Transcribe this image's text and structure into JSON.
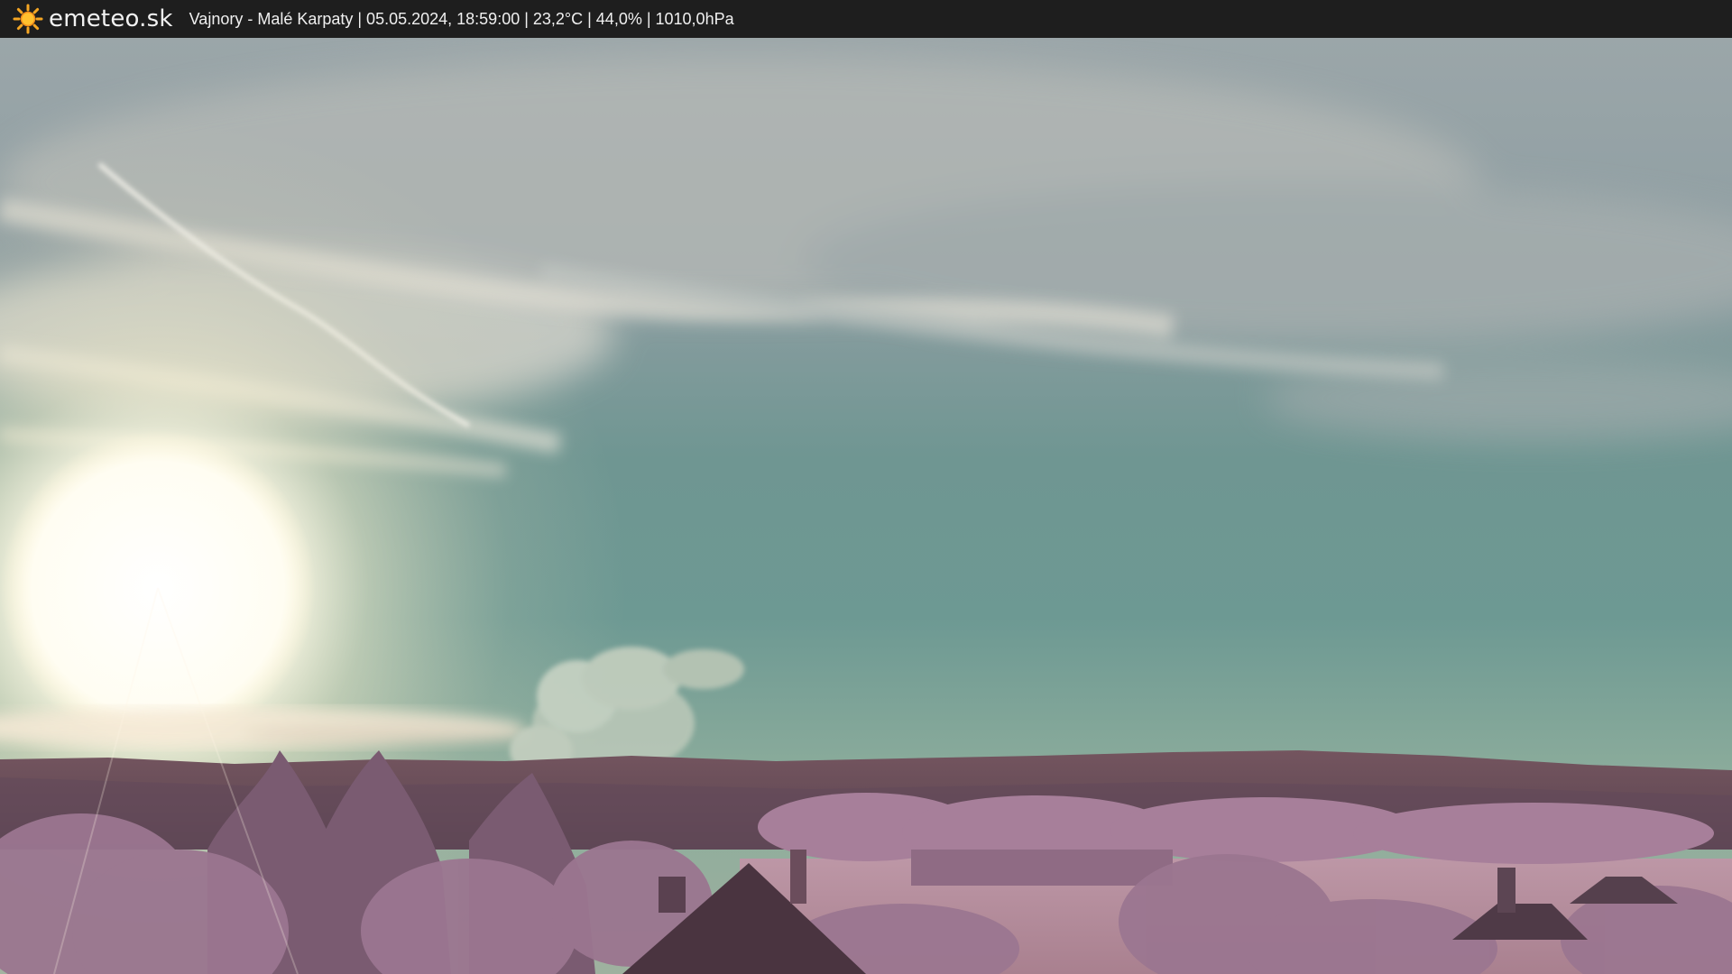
{
  "header": {
    "brand": "emeteo.sk",
    "logo_icon": "sun-icon",
    "caption": "Vajnory - Malé Karpaty | 05.05.2024, 18:59:00 | 23,2°C | 44,0% | 1010,0hPa"
  },
  "colors": {
    "bar_bg": "#1e1e1e",
    "sun_icon": "#f5a623",
    "sky_top": "#9aa4a6",
    "sky_mid": "#6c9590",
    "sky_low": "#86a99a",
    "hills": "#6e5560",
    "foliage": "#b58aa6",
    "field": "#b58e9e"
  }
}
